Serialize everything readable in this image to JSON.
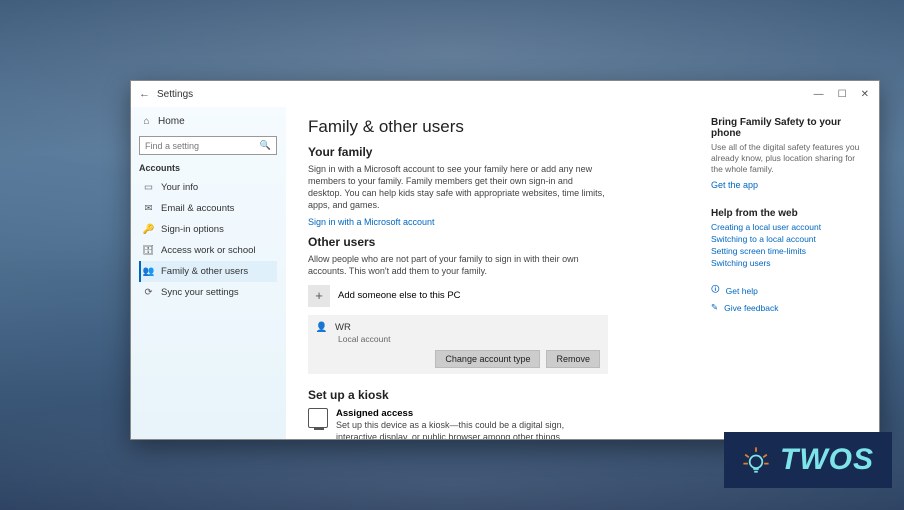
{
  "window": {
    "title": "Settings"
  },
  "sidebar": {
    "home": "Home",
    "search_placeholder": "Find a setting",
    "section": "Accounts",
    "items": [
      {
        "label": "Your info"
      },
      {
        "label": "Email & accounts"
      },
      {
        "label": "Sign-in options"
      },
      {
        "label": "Access work or school"
      },
      {
        "label": "Family & other users"
      },
      {
        "label": "Sync your settings"
      }
    ]
  },
  "main": {
    "heading": "Family & other users",
    "family": {
      "title": "Your family",
      "body": "Sign in with a Microsoft account to see your family here or add any new members to your family. Family members get their own sign-in and desktop. You can help kids stay safe with appropriate websites, time limits, apps, and games.",
      "link": "Sign in with a Microsoft account"
    },
    "other": {
      "title": "Other users",
      "body": "Allow people who are not part of your family to sign in with their own accounts. This won't add them to your family.",
      "add_label": "Add someone else to this PC",
      "user": {
        "name": "WR",
        "type": "Local account",
        "change_btn": "Change account type",
        "remove_btn": "Remove"
      }
    },
    "kiosk": {
      "title": "Set up a kiosk",
      "item_title": "Assigned access",
      "item_body": "Set up this device as a kiosk—this could be a digital sign, interactive display, or public browser among other things."
    }
  },
  "right": {
    "promo_title": "Bring Family Safety to your phone",
    "promo_body": "Use all of the digital safety features you already know, plus location sharing for the whole family.",
    "promo_link": "Get the app",
    "web_title": "Help from the web",
    "web_links": [
      "Creating a local user account",
      "Switching to a local account",
      "Setting screen time-limits",
      "Switching users"
    ],
    "help": "Get help",
    "feedback": "Give feedback"
  },
  "badge": {
    "text": "TWOS"
  }
}
